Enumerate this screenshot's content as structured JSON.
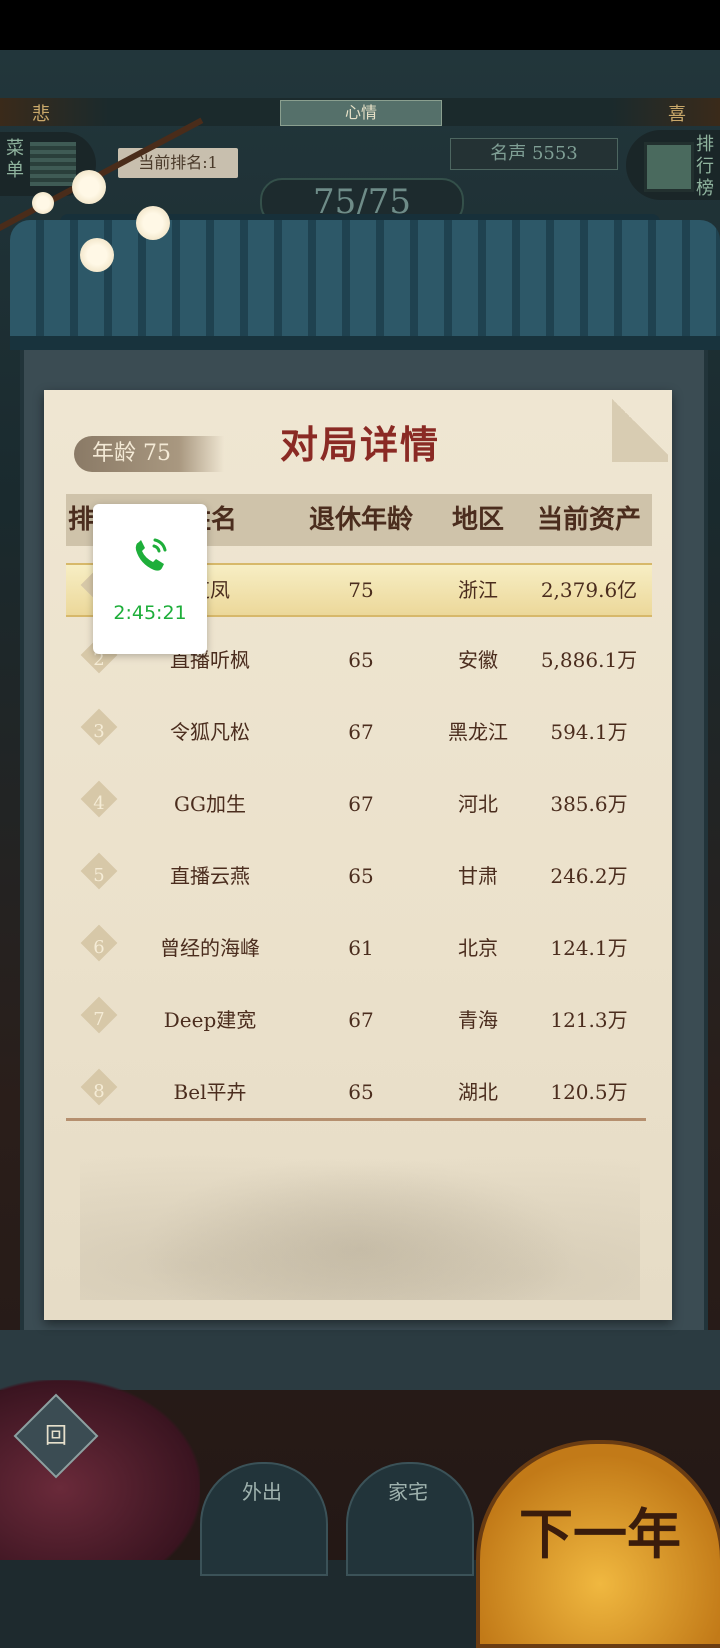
{
  "hud": {
    "mood_left": "悲",
    "mood_center": "心情",
    "mood_right": "喜",
    "menu_label": "菜单",
    "current_rank": "当前排名:1",
    "fame": "名声 5553",
    "rankboard_label": "排行榜",
    "turn_counter": "75/75"
  },
  "panel": {
    "age_tag": "年龄 75",
    "title": "对局详情",
    "headers": [
      "排名",
      "姓名",
      "退休年龄",
      "地区",
      "当前资产"
    ],
    "rows": [
      {
        "rank": "1",
        "name": "芝凤",
        "retire_age": "75",
        "region": "浙江",
        "assets": "2,379.6亿"
      },
      {
        "rank": "2",
        "name": "直播听枫",
        "retire_age": "65",
        "region": "安徽",
        "assets": "5,886.1万"
      },
      {
        "rank": "3",
        "name": "令狐凡松",
        "retire_age": "67",
        "region": "黑龙江",
        "assets": "594.1万"
      },
      {
        "rank": "4",
        "name": "GG加生",
        "retire_age": "67",
        "region": "河北",
        "assets": "385.6万"
      },
      {
        "rank": "5",
        "name": "直播云燕",
        "retire_age": "65",
        "region": "甘肃",
        "assets": "246.2万"
      },
      {
        "rank": "6",
        "name": "曾经的海峰",
        "retire_age": "61",
        "region": "北京",
        "assets": "124.1万"
      },
      {
        "rank": "7",
        "name": "Deep建宽",
        "retire_age": "67",
        "region": "青海",
        "assets": "121.3万"
      },
      {
        "rank": "8",
        "name": "Bel平卉",
        "retire_age": "65",
        "region": "湖北",
        "assets": "120.5万"
      }
    ]
  },
  "call_overlay": {
    "icon": "phone-icon",
    "duration": "2:45:21",
    "color": "#1eae3a"
  },
  "bottom_nav": {
    "back_label": "回",
    "go_out_label": "外出",
    "home_label": "家宅",
    "next_year_label": "下一年"
  }
}
